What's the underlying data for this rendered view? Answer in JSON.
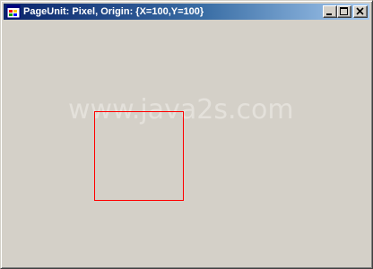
{
  "window": {
    "title": "PageUnit: Pixel, Origin: {X=100,Y=100}",
    "buttons": {
      "minimize_icon": "minimize-icon",
      "maximize_icon": "maximize-icon",
      "close_icon": "close-icon"
    }
  },
  "client": {
    "watermark": "www.java2s.com",
    "rectangle_color": "#ff0000"
  }
}
